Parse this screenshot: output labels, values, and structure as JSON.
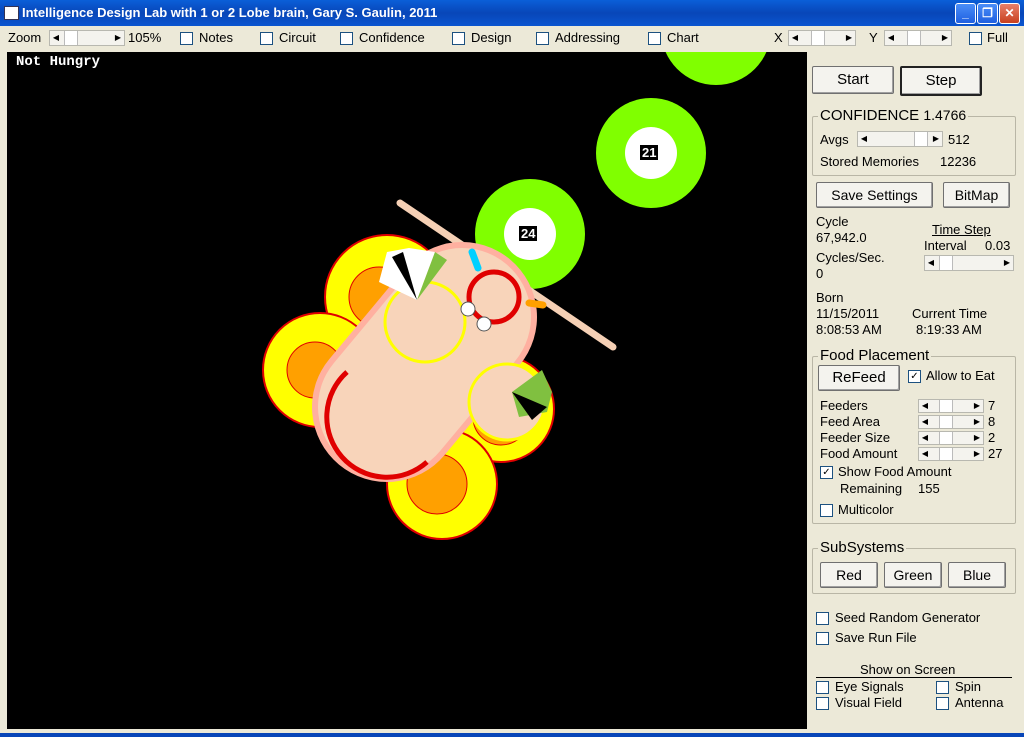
{
  "window": {
    "title": "Intelligence Design Lab with 1 or 2 Lobe brain, Gary S. Gaulin, 2011"
  },
  "toolbar": {
    "zoom_label": "Zoom",
    "zoom_value": "105%",
    "checks": [
      {
        "label": "Notes",
        "checked": false
      },
      {
        "label": "Circuit",
        "checked": false
      },
      {
        "label": "Confidence",
        "checked": false
      },
      {
        "label": "Design",
        "checked": false
      },
      {
        "label": "Addressing",
        "checked": false
      },
      {
        "label": "Chart",
        "checked": false
      }
    ],
    "x_label": "X",
    "y_label": "Y",
    "full_label": "Full"
  },
  "canvas": {
    "status": "Not Hungry",
    "food_labels": [
      "21",
      "24"
    ]
  },
  "controls": {
    "start": "Start",
    "step": "Step",
    "confidence_title": "CONFIDENCE",
    "confidence_value": "1.4766",
    "avgs_label": "Avgs",
    "avgs_value": "512",
    "stored_memories_label": "Stored Memories",
    "stored_memories_value": "12236",
    "save_settings": "Save Settings",
    "bitmap": "BitMap",
    "cycle_label": "Cycle",
    "cycle_value": "67,942.0",
    "time_step_label": "Time Step",
    "interval_label": "Interval",
    "interval_value": "0.03",
    "cycles_sec_label": "Cycles/Sec.",
    "cycles_sec_value": "0",
    "born_label": "Born",
    "born_date": "11/15/2011",
    "born_time": "8:08:53 AM",
    "current_time_label": "Current Time",
    "current_time_value": "8:19:33 AM"
  },
  "food": {
    "title": "Food Placement",
    "refeed": "ReFeed",
    "allow_to_eat": "Allow to Eat",
    "rows": [
      {
        "label": "Feeders",
        "value": "7"
      },
      {
        "label": "Feed Area",
        "value": "8"
      },
      {
        "label": "Feeder Size",
        "value": "2"
      },
      {
        "label": "Food Amount",
        "value": "27"
      }
    ],
    "show_food_amount": "Show Food Amount",
    "remaining_label": "Remaining",
    "remaining_value": "155",
    "multicolor": "Multicolor"
  },
  "subsystems": {
    "title": "SubSystems",
    "red": "Red",
    "green": "Green",
    "blue": "Blue"
  },
  "options": {
    "seed": "Seed Random Generator",
    "save_run": "Save Run File"
  },
  "show_on_screen": {
    "title": "Show on Screen",
    "eye": "Eye Signals",
    "spin": "Spin",
    "visual": "Visual Field",
    "antenna": "Antenna"
  }
}
